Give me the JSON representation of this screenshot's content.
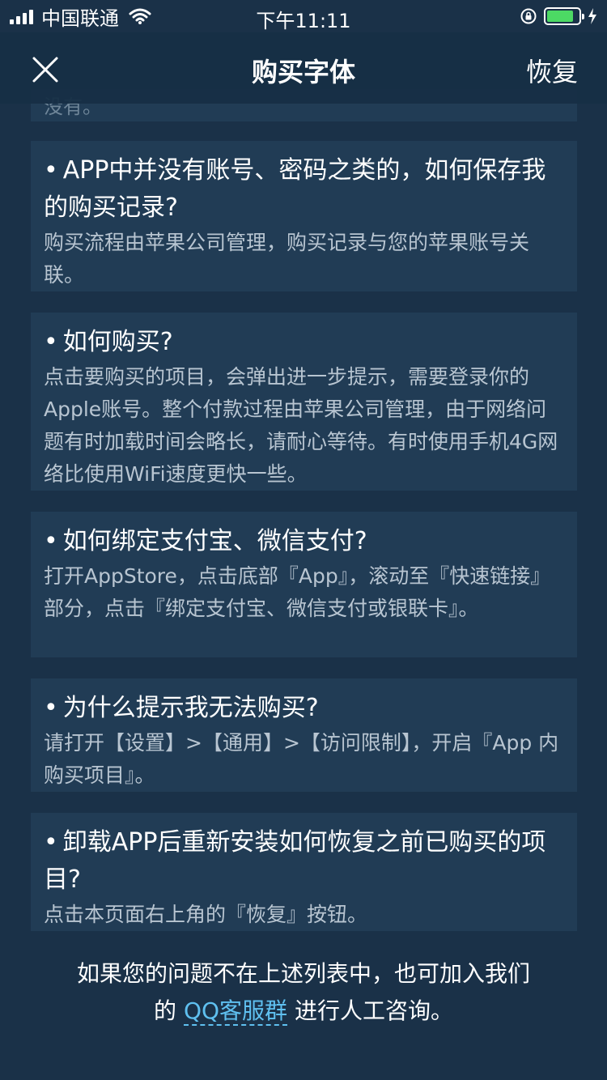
{
  "status": {
    "carrier": "中国联通",
    "time": "下午11:11",
    "battery_level": 0.85,
    "battery_color": "#4cd964"
  },
  "nav": {
    "title": "购买字体",
    "restore_label": "恢复",
    "close_icon": "close-icon"
  },
  "faq": {
    "partial_text": "没有。",
    "items": [
      {
        "question": "APP中并没有账号、密码之类的，如何保存我的购买记录?",
        "answer": "购买流程由苹果公司管理，购买记录与您的苹果账号关联。"
      },
      {
        "question": "如何购买?",
        "answer": "点击要购买的项目，会弹出进一步提示，需要登录你的Apple账号。整个付款过程由苹果公司管理，由于网络问题有时加载时间会略长，请耐心等待。有时使用手机4G网络比使用WiFi速度更快一些。"
      },
      {
        "question": "如何绑定支付宝、微信支付?",
        "answer": "打开AppStore，点击底部『App』，滚动至『快速链接』部分，点击『绑定支付宝、微信支付或银联卡』。"
      },
      {
        "question": "为什么提示我无法购买?",
        "answer": "请打开【设置】>【通用】>【访问限制】，开启『App 内购买项目』。"
      },
      {
        "question": "卸载APP后重新安装如何恢复之前已购买的项目?",
        "answer": "点击本页面右上角的『恢复』按钮。"
      }
    ],
    "bullet": "•"
  },
  "footer": {
    "line1": "如果您的问题不在上述列表中，也可加入我们",
    "prefix": "的",
    "link_text": "QQ客服群",
    "suffix": "进行人工咨询。",
    "link_color": "#5fc0f0"
  }
}
